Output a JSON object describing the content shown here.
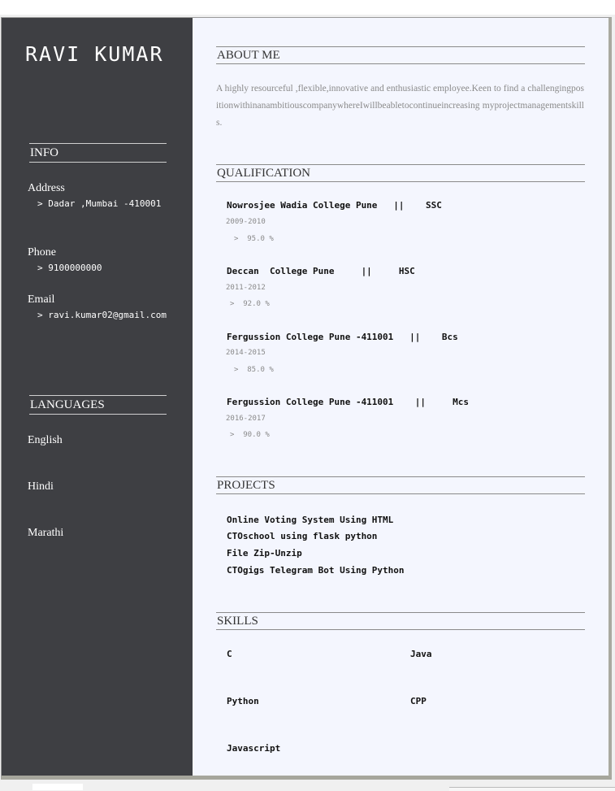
{
  "name": "RAVI KUMAR",
  "info": {
    "heading": "INFO",
    "address_label": "Address",
    "address_value": "> Dadar ,Mumbai -410001",
    "phone_label": "Phone",
    "phone_value": "> 9100000000",
    "email_label": "Email",
    "email_value": "> ravi.kumar02@gmail.com"
  },
  "languages": {
    "heading": "LANGUAGES",
    "items": [
      "English",
      "Hindi",
      "Marathi"
    ]
  },
  "about": {
    "heading": "ABOUT ME",
    "text": "A highly resourceful ,flexible,innovative and enthusiastic employee.Keen to find a challengingpositionwithinanambitiouscompanywhereIwillbeabletocontinueincreasing myprojectmanagementskills."
  },
  "qualification": {
    "heading": "QUALIFICATION",
    "items": [
      {
        "title": "Nowrosjee Wadia College Pune   ||    SSC",
        "years": "2009-2010",
        "score": ">  95.0 %"
      },
      {
        "title": "Deccan  College Pune     ||     HSC",
        "years": "2011-2012",
        "score": ">  92.0 %"
      },
      {
        "title": "Fergussion College Pune -411001   ||    Bcs",
        "years": "2014-2015",
        "score": ">  85.0 %"
      },
      {
        "title": "Fergussion College Pune -411001    ||     Mcs",
        "years": "2016-2017",
        "score": ">  90.0 %"
      }
    ]
  },
  "projects": {
    "heading": "PROJECTS",
    "items": [
      "Online Voting System Using HTML",
      "CTOschool using flask python",
      "File Zip-Unzip",
      "CTOgigs Telegram Bot Using Python"
    ]
  },
  "skills": {
    "heading": "SKILLS",
    "items": [
      "C",
      "Java",
      "Python",
      "CPP",
      "Javascript"
    ]
  }
}
